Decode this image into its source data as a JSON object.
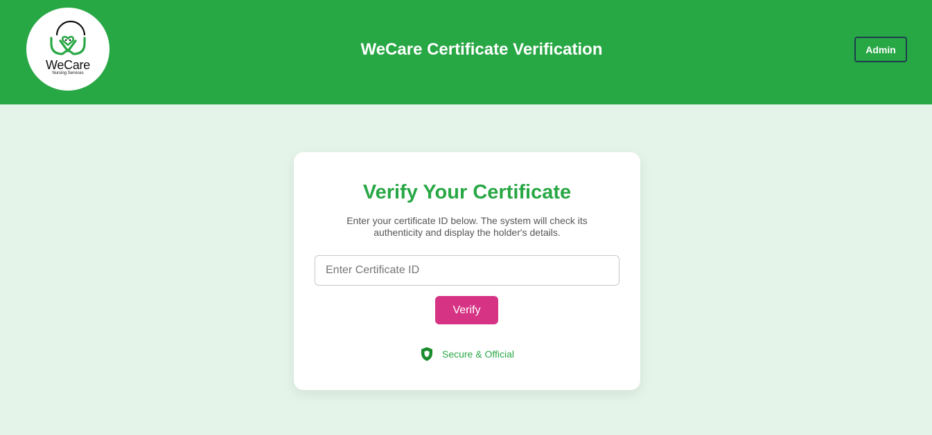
{
  "header": {
    "logo": {
      "icon": "wecare-heart-logo-icon",
      "name": "WeCare",
      "tagline": "Nursing Services"
    },
    "title": "WeCare Certificate Verification",
    "admin_label": "Admin"
  },
  "card": {
    "title": "Verify Your Certificate",
    "description": "Enter your certificate ID below. The system will check its authenticity and display the holder's details.",
    "input": {
      "placeholder": "Enter Certificate ID",
      "value": ""
    },
    "verify_label": "Verify",
    "secure": {
      "icon": "shield-icon",
      "label": "Secure & Official"
    }
  },
  "colors": {
    "brand_green": "#28a745",
    "page_background": "#e5f4e9",
    "verify_pink": "#d63384",
    "admin_border": "#1c3d4f"
  }
}
